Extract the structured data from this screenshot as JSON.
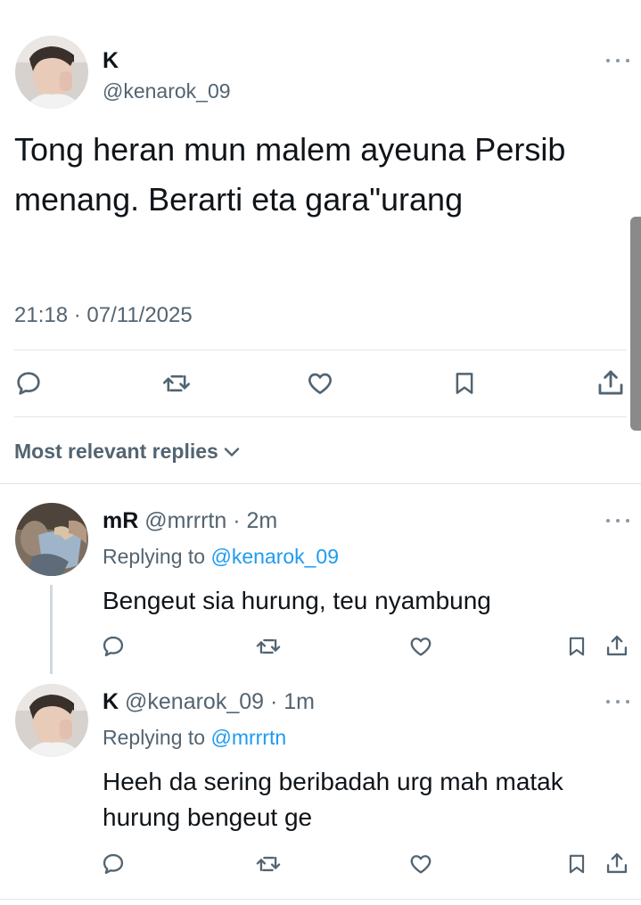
{
  "tweet": {
    "author_name": "K",
    "author_handle": "@kenarok_09",
    "text": "Tong heran mun malem ayeuna Persib menang. Berarti eta gara\"urang",
    "timestamp": "21:18 · 07/11/2025"
  },
  "actions": {
    "icons": [
      "reply-icon",
      "retweet-icon",
      "like-icon",
      "bookmark-icon",
      "share-icon"
    ]
  },
  "replies_section": {
    "sort_label": "Most relevant replies"
  },
  "replies": [
    {
      "name": "mR",
      "handle": "@mrrrtn",
      "time": " · 2m",
      "replying_prefix": "Replying to ",
      "replying_to": "@kenarok_09",
      "text": "Bengeut sia hurung, teu nyambung"
    },
    {
      "name": "K",
      "handle": "@kenarok_09",
      "time": " · 1m",
      "replying_prefix": "Replying to ",
      "replying_to": "@mrrrtn",
      "text": "Heeh da sering beribadah urg mah matak hurung bengeut ge"
    }
  ],
  "colors": {
    "link": "#1d9bf0",
    "secondary_text": "#536471",
    "divider": "#e1e6ea"
  }
}
